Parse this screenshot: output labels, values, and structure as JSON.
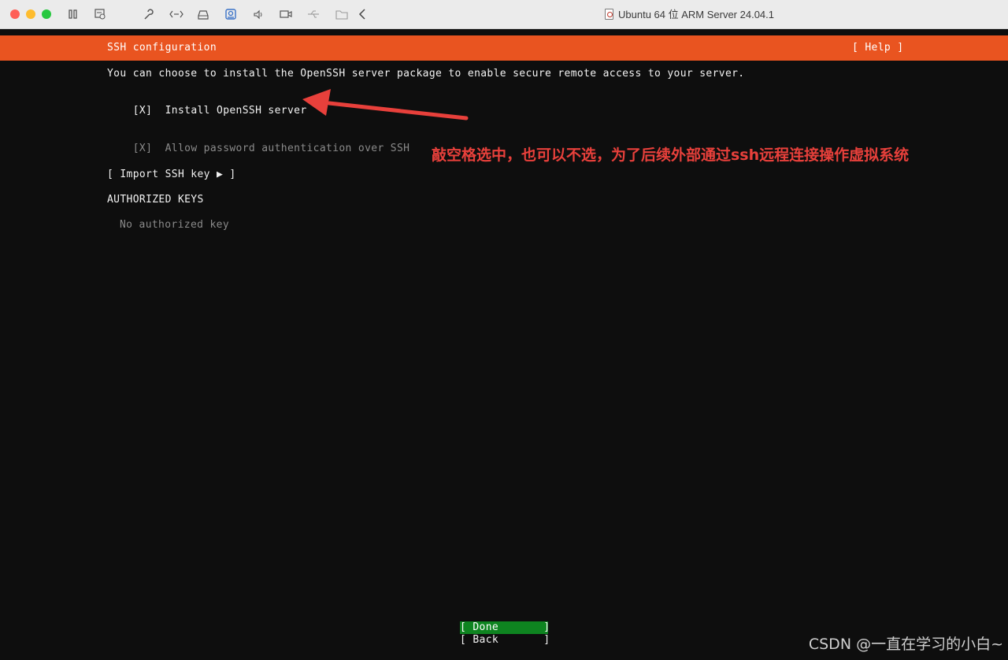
{
  "window": {
    "title": "Ubuntu 64 位 ARM Server 24.04.1",
    "toolbar_icons": [
      "pause-icon",
      "snapshot-icon",
      "wrench-icon",
      "network-icon",
      "drive-icon",
      "camera-icon",
      "sound-icon",
      "video-camera-icon",
      "usb-icon",
      "shared-folder-icon",
      "chevron-left-icon"
    ]
  },
  "installer": {
    "header_title": "SSH configuration",
    "help_button": "[ Help ]",
    "description": "You can choose to install the OpenSSH server package to enable secure remote access to your server.",
    "install_openssh": {
      "box": "[X]",
      "label": "Install OpenSSH server",
      "checked": true
    },
    "allow_password": {
      "box": "[X]",
      "label": "Allow password authentication over SSH",
      "checked": true
    },
    "import_key_button": "[ Import SSH key ▶ ]",
    "authorized_keys_heading": "AUTHORIZED KEYS",
    "no_keys_text": "No authorized key",
    "done_button": "[ Done       ]",
    "back_button": "[ Back       ]"
  },
  "annotation": {
    "text": "敲空格选中，也可以不选，为了后续外部通过ssh远程连接操作虚拟系统"
  },
  "watermark": "CSDN @一直在学习的小白~",
  "colors": {
    "header_bg": "#e95420",
    "done_bg": "#0e8420",
    "annotation": "#e8403b",
    "terminal_bg": "#0e0e0e"
  }
}
